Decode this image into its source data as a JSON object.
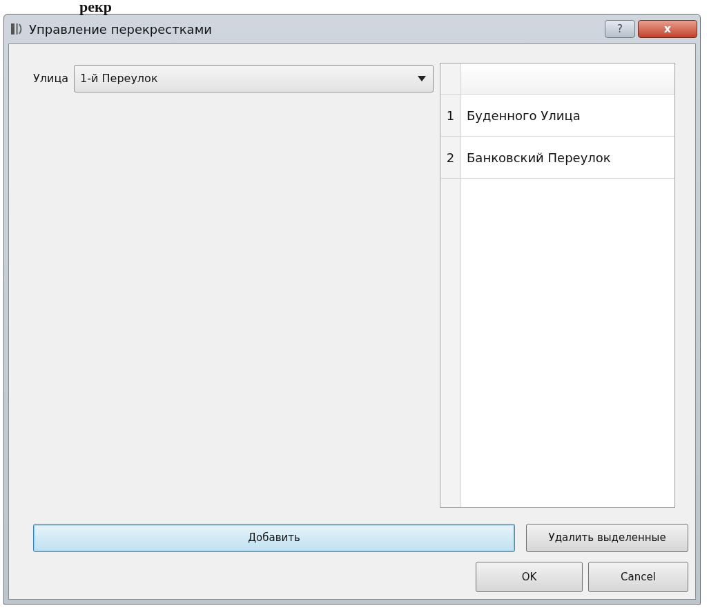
{
  "heading_fragment": "рекр",
  "window": {
    "title": "Управление перекрестками",
    "help_button": "?",
    "close_button": "x"
  },
  "street": {
    "label": "Улица",
    "value": "1-й Переулок"
  },
  "table": {
    "rows": [
      {
        "number": "1",
        "name": "Буденного Улица"
      },
      {
        "number": "2",
        "name": "Банковский Переулок"
      }
    ]
  },
  "buttons": [
    {
      "label": "Добавить",
      "kind": "add",
      "focused": true
    },
    {
      "label": "Удалить выделенные",
      "kind": "remove",
      "focused": false
    }
  ],
  "dialog_buttons": [
    "OK",
    "Cancel"
  ]
}
